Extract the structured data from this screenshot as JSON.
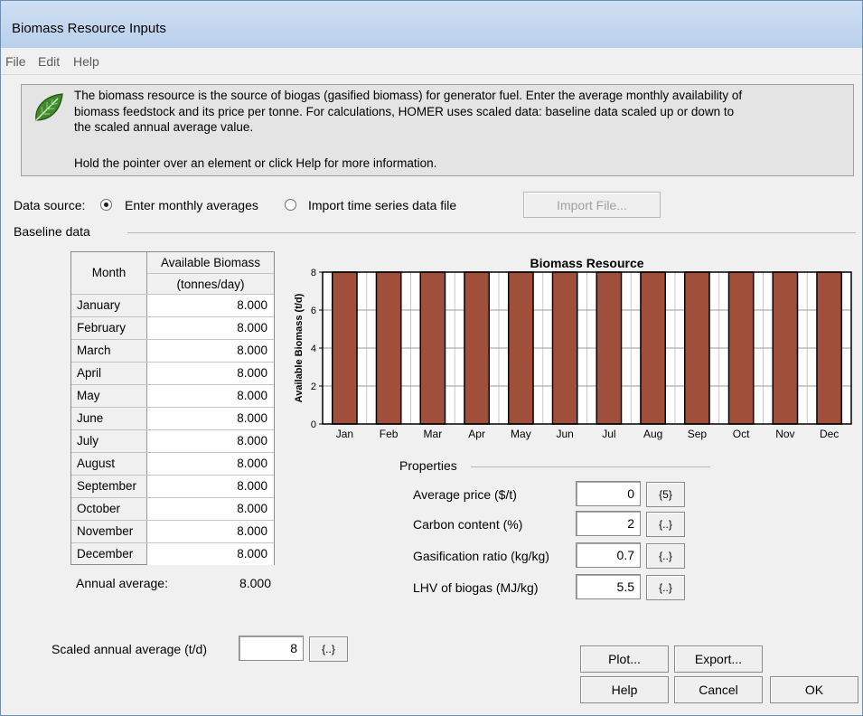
{
  "window": {
    "title": "Biomass Resource Inputs"
  },
  "menu": {
    "file": "File",
    "edit": "Edit",
    "help": "Help"
  },
  "info": {
    "icon": "leaf-icon",
    "lines": [
      "The biomass resource is the source of biogas (gasified biomass) for generator fuel. Enter the average monthly availability of",
      "biomass feedstock and its price per tonne. For calculations, HOMER uses scaled data: baseline data scaled up or down to",
      "the scaled annual average value."
    ],
    "hint": "Hold the pointer over an element or click Help for more information."
  },
  "data_source": {
    "label": "Data source:",
    "option_monthly": "Enter monthly averages",
    "option_import": "Import time series data file",
    "selected": "Enter monthly averages",
    "import_button": "Import File..."
  },
  "baseline": {
    "group_label": "Baseline data",
    "col_month": "Month",
    "col_value_line1": "Available Biomass",
    "col_value_line2": "(tonnes/day)",
    "rows": [
      {
        "month": "January",
        "value": "8.000"
      },
      {
        "month": "February",
        "value": "8.000"
      },
      {
        "month": "March",
        "value": "8.000"
      },
      {
        "month": "April",
        "value": "8.000"
      },
      {
        "month": "May",
        "value": "8.000"
      },
      {
        "month": "June",
        "value": "8.000"
      },
      {
        "month": "July",
        "value": "8.000"
      },
      {
        "month": "August",
        "value": "8.000"
      },
      {
        "month": "September",
        "value": "8.000"
      },
      {
        "month": "October",
        "value": "8.000"
      },
      {
        "month": "November",
        "value": "8.000"
      },
      {
        "month": "December",
        "value": "8.000"
      }
    ],
    "annual_label": "Annual average:",
    "annual_value": "8.000"
  },
  "chart_data": {
    "type": "bar",
    "title": "Biomass Resource",
    "xlabel": "",
    "ylabel": "Available Biomass (t/d)",
    "categories": [
      "Jan",
      "Feb",
      "Mar",
      "Apr",
      "May",
      "Jun",
      "Jul",
      "Aug",
      "Sep",
      "Oct",
      "Nov",
      "Dec"
    ],
    "values": [
      8,
      8,
      8,
      8,
      8,
      8,
      8,
      8,
      8,
      8,
      8,
      8
    ],
    "ylim": [
      0,
      8
    ],
    "yticks": [
      0,
      2,
      4,
      6,
      8
    ],
    "grid": true,
    "bar_color": "#a0503a"
  },
  "properties": {
    "group_label": "Properties",
    "price_label": "Average price ($/t)",
    "price_value": "0",
    "price_sens": "{5}",
    "carbon_label": "Carbon content (%)",
    "carbon_value": "2",
    "carbon_sens": "{..}",
    "gasification_label": "Gasification ratio (kg/kg)",
    "gasification_value": "0.7",
    "gasification_sens": "{..}",
    "lhv_label": "LHV of biogas (MJ/kg)",
    "lhv_value": "5.5",
    "lhv_sens": "{..}"
  },
  "scaled": {
    "label": "Scaled annual average (t/d)",
    "value": "8",
    "sens": "{..}"
  },
  "buttons": {
    "plot": "Plot...",
    "export": "Export...",
    "help": "Help",
    "cancel": "Cancel",
    "ok": "OK"
  }
}
